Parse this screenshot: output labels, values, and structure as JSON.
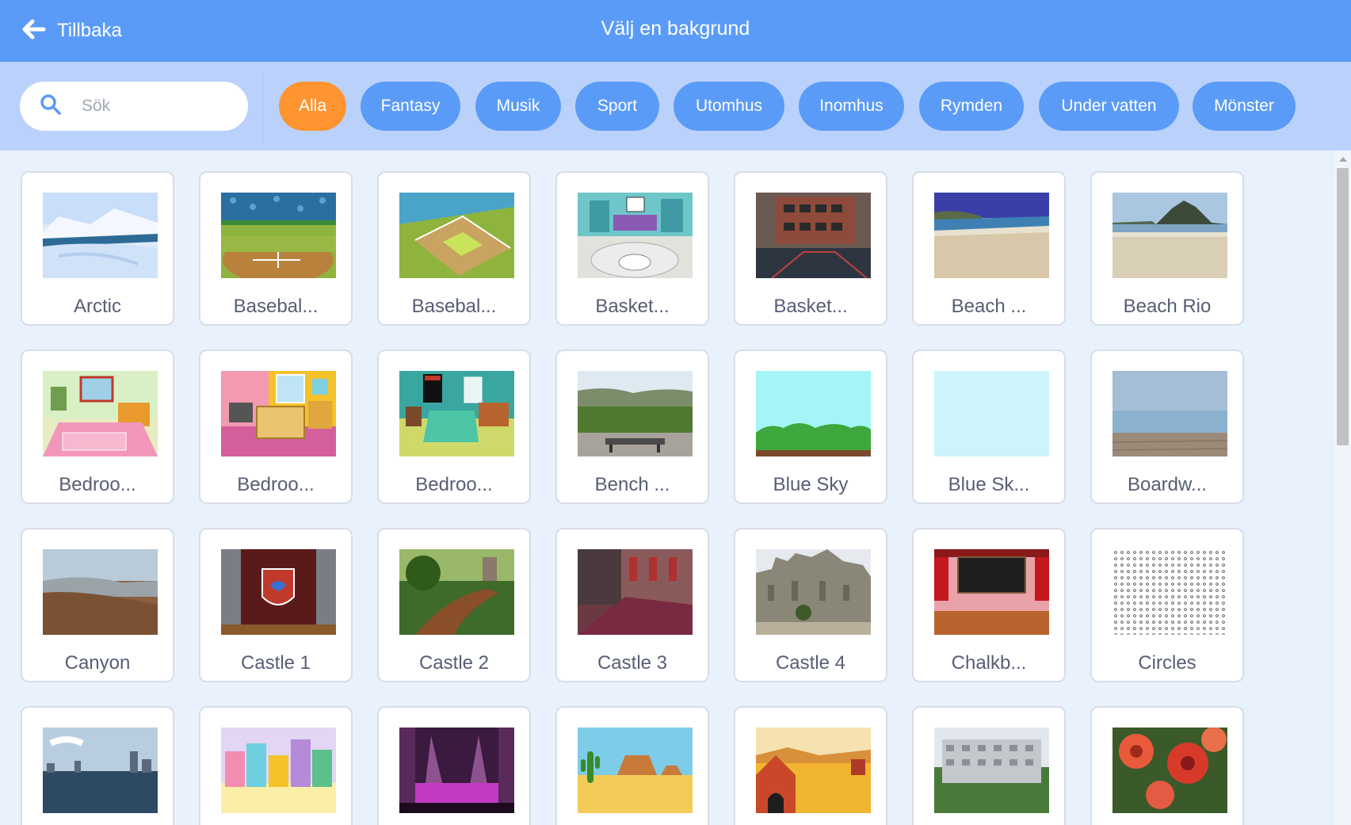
{
  "header": {
    "back_label": "Tillbaka",
    "title": "Välj en bakgrund"
  },
  "search": {
    "placeholder": "Sök"
  },
  "tags": [
    {
      "label": "Alla",
      "active": true
    },
    {
      "label": "Fantasy",
      "active": false
    },
    {
      "label": "Musik",
      "active": false
    },
    {
      "label": "Sport",
      "active": false
    },
    {
      "label": "Utomhus",
      "active": false
    },
    {
      "label": "Inomhus",
      "active": false
    },
    {
      "label": "Rymden",
      "active": false
    },
    {
      "label": "Under vatten",
      "active": false
    },
    {
      "label": "Mönster",
      "active": false
    }
  ],
  "colors": {
    "header": "#5b9bf8",
    "filter_bar": "#bad2fb",
    "tag": "#5b9bf8",
    "tag_active": "#ff9430",
    "background": "#e9f1fc",
    "card_text": "#575e75"
  },
  "backdrops": [
    "Arctic",
    "Basebal...",
    "Basebal...",
    "Basket...",
    "Basket...",
    "Beach ...",
    "Beach Rio",
    "Bedroo...",
    "Bedroo...",
    "Bedroo...",
    "Bench ...",
    "Blue Sky",
    "Blue Sk...",
    "Boardw...",
    "Canyon",
    "Castle 1",
    "Castle 2",
    "Castle 3",
    "Castle 4",
    "Chalkb...",
    "Circles",
    "",
    "",
    "",
    "",
    "",
    "",
    ""
  ]
}
